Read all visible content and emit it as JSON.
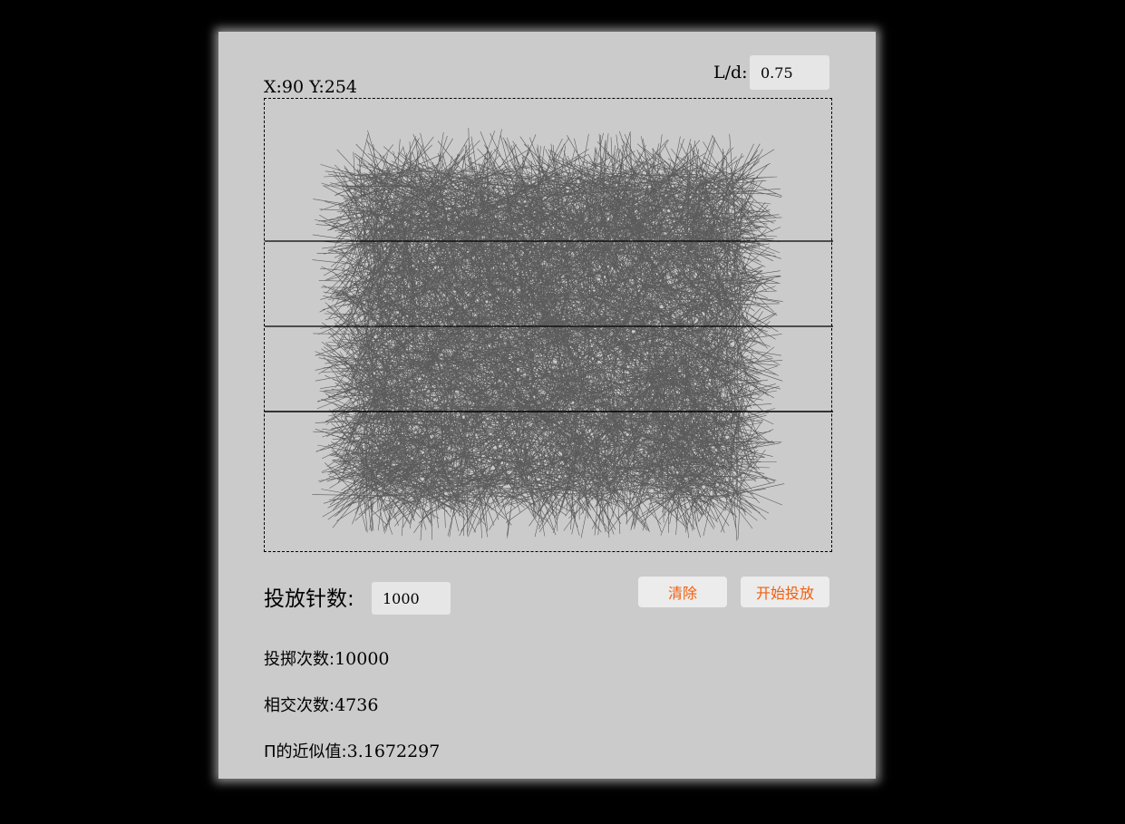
{
  "coords": {
    "text": "X:90 Y:254"
  },
  "ratio": {
    "label": "L/d:",
    "value": "0.75"
  },
  "controls": {
    "needle_count_label": "投放针数:",
    "needle_count_value": "1000",
    "clear_label": "清除",
    "start_label": "开始投放"
  },
  "stats": {
    "throws_label": "投掷次数:",
    "throws_value": "10000",
    "crossings_label": "相交次数:",
    "crossings_value": "4736",
    "pi_label": "Π的近似值:",
    "pi_value": "3.1672297"
  },
  "colors": {
    "accent": "#f25e0d",
    "panel": "#cbcbcb",
    "needle": "#000000"
  }
}
